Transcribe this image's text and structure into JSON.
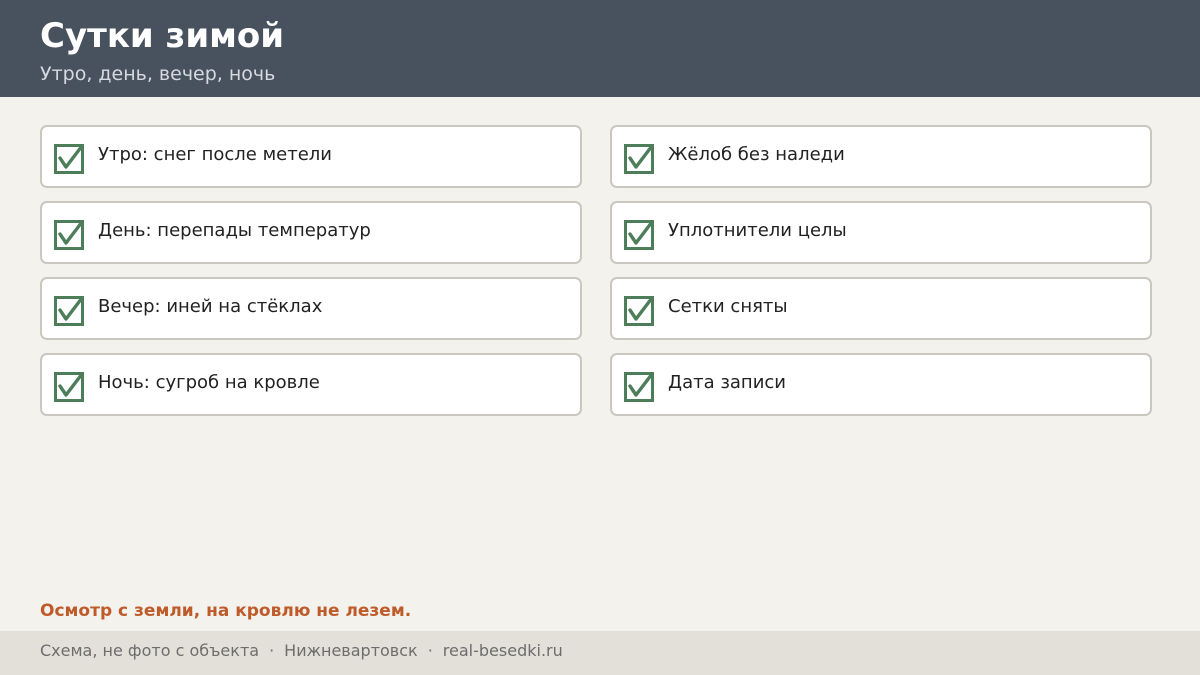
{
  "header": {
    "title": "Сутки зимой",
    "subtitle": "Утро, день, вечер, ночь"
  },
  "checklist": {
    "left": [
      {
        "label": "Утро: снег после метели",
        "checked": true
      },
      {
        "label": "День: перепады температур",
        "checked": true
      },
      {
        "label": "Вечер: иней на стёклах",
        "checked": true
      },
      {
        "label": "Ночь: сугроб на кровле",
        "checked": true
      }
    ],
    "right": [
      {
        "label": "Жёлоб без наледи",
        "checked": true
      },
      {
        "label": "Уплотнители целы",
        "checked": true
      },
      {
        "label": "Сетки сняты",
        "checked": true
      },
      {
        "label": "Дата записи",
        "checked": true
      }
    ]
  },
  "warning": "Осмотр с земли, на кровлю не лезем.",
  "footer": {
    "note": "Схема, не фото с объекта",
    "separator": "·",
    "city": "Нижневартовск",
    "site": "real-besedki.ru"
  },
  "colors": {
    "header_bg": "#48515e",
    "check": "#4e7d5a",
    "warning": "#bf5a2a",
    "footer_bg": "#e3e0da"
  },
  "icons": {
    "checkbox": "checked-checkbox-icon"
  }
}
